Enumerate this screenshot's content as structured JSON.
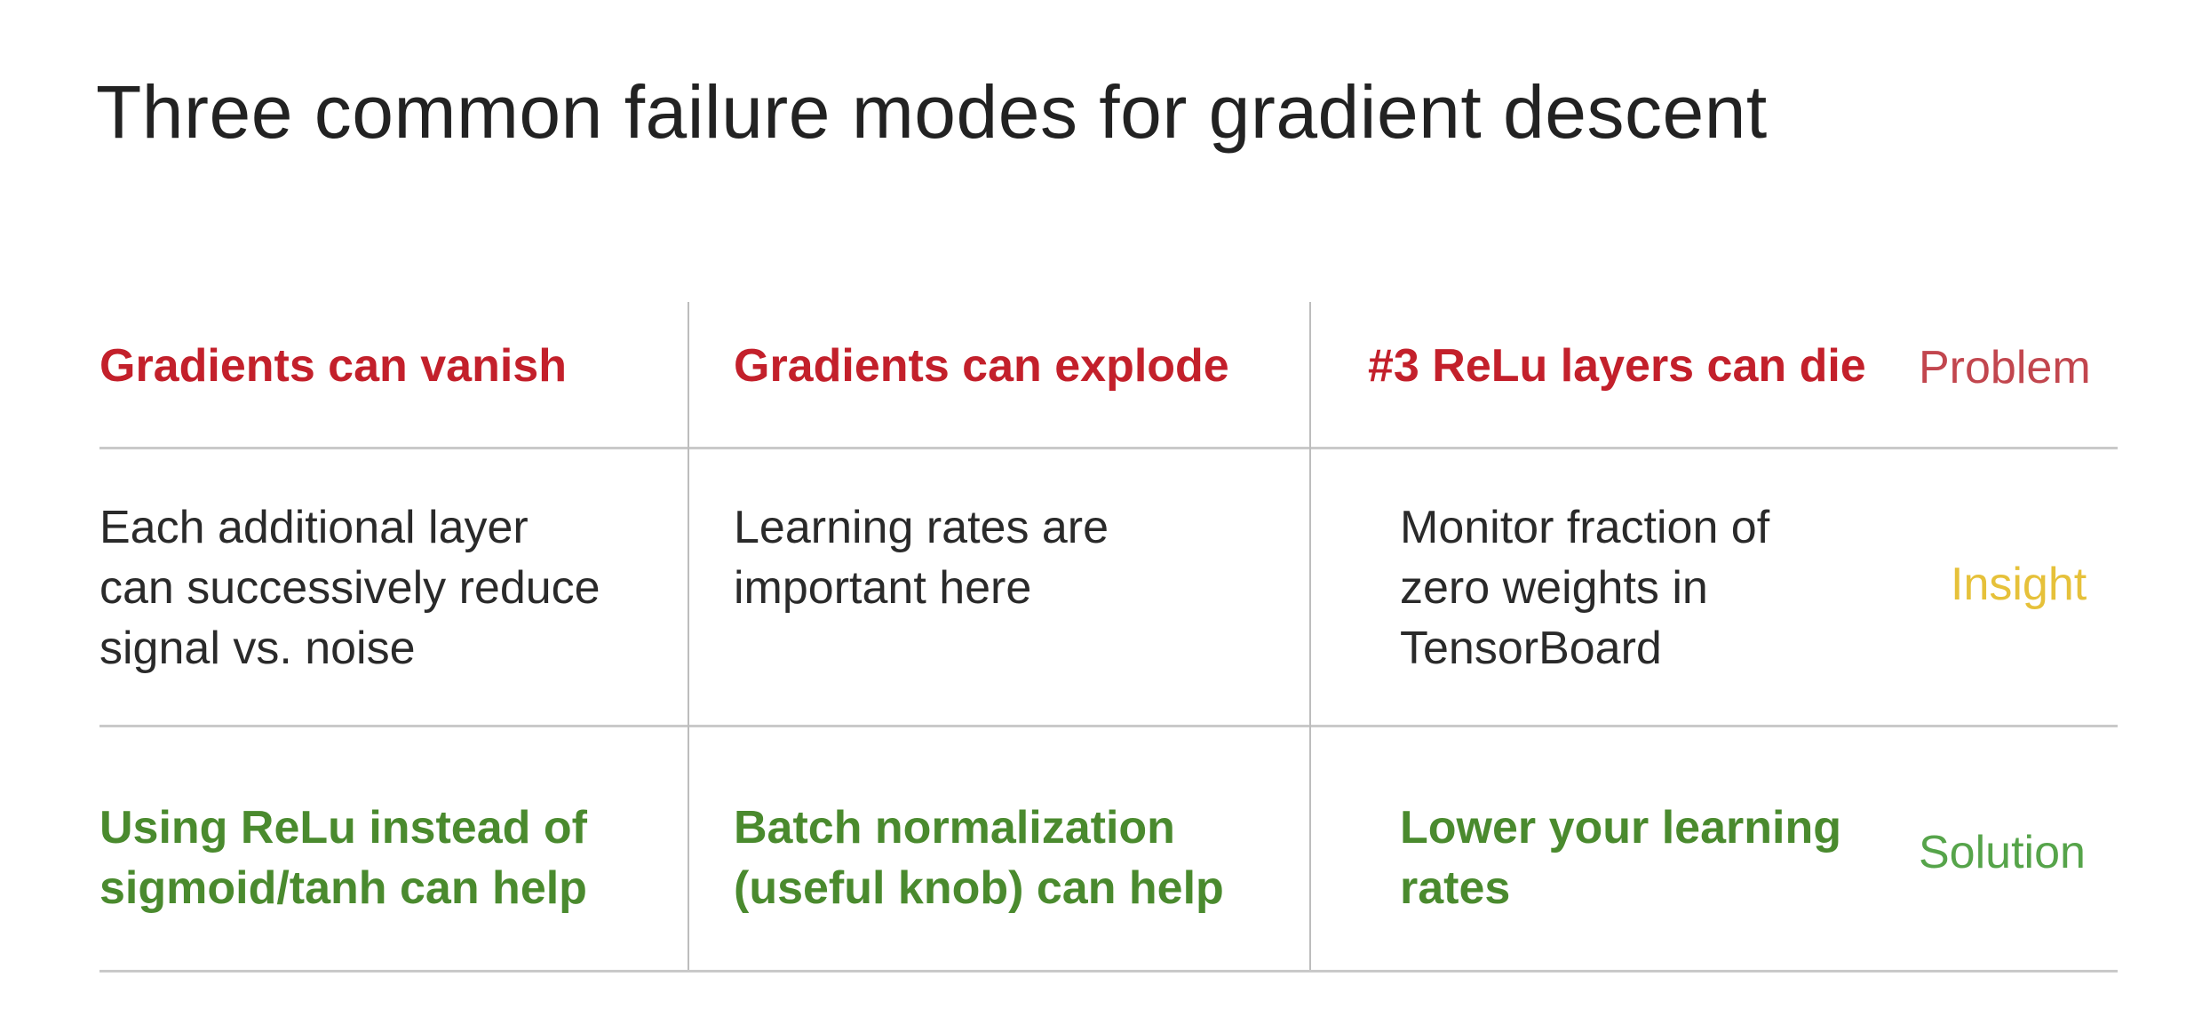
{
  "slide": {
    "title": "Three common failure modes for gradient descent"
  },
  "row_labels": {
    "problem": "Problem",
    "insight": "Insight",
    "solution": "Solution"
  },
  "colors": {
    "problem": "#c3202b",
    "problem_label": "#c2464e",
    "insight_label": "#e6c13a",
    "solution": "#4a8a2e",
    "solution_label": "#56a44a",
    "body_text": "#2a2a2a",
    "grid_lines": "#c9c9c9"
  },
  "columns": [
    {
      "problem": "Gradients can vanish",
      "insight": [
        "Each additional layer",
        "can successively reduce",
        "signal vs. noise"
      ],
      "solution": [
        "Using ReLu instead of",
        "sigmoid/tanh can help"
      ]
    },
    {
      "problem": "Gradients can explode",
      "insight": [
        "Learning rates are",
        "important here"
      ],
      "solution": [
        "Batch normalization",
        "(useful knob) can help"
      ]
    },
    {
      "problem": "#3 ReLu layers can die",
      "insight": [
        "Monitor fraction of",
        "zero weights in",
        "TensorBoard"
      ],
      "solution": [
        "Lower your learning",
        "rates"
      ]
    }
  ]
}
